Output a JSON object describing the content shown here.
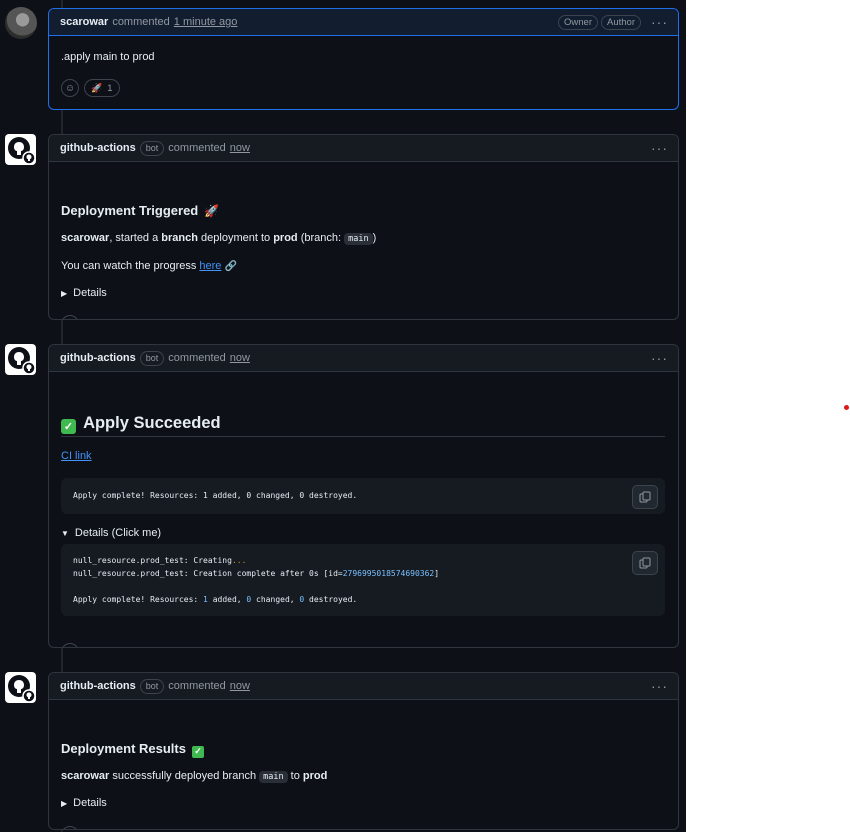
{
  "comment1": {
    "author": "scarowar",
    "action": "commented",
    "time": "1 minute ago",
    "badges": [
      "Owner",
      "Author"
    ],
    "body_text": ".apply main to prod",
    "reaction_emoji": "🚀",
    "reaction_count": "1"
  },
  "comment2": {
    "author": "github-actions",
    "bot_badge": "bot",
    "action": "commented",
    "time": "now",
    "heading": "Deployment Triggered",
    "heading_emoji": "🚀",
    "line1": {
      "user": "scarowar",
      "text_a": ", started a ",
      "kind": "branch",
      "text_b": " deployment to ",
      "env": "prod",
      "text_c": " (branch: ",
      "branch": "main",
      "text_d": ")"
    },
    "line2": {
      "text": "You can watch the progress ",
      "link": "here",
      "link_emoji": "🔗"
    },
    "details": "Details"
  },
  "comment3": {
    "author": "github-actions",
    "bot_badge": "bot",
    "action": "commented",
    "time": "now",
    "heading": "Apply Succeeded",
    "ci_link": "CI link",
    "summary_code": "Apply complete! Resources: 1 added, 0 changed, 0 destroyed.",
    "details": "Details (Click me)",
    "log": {
      "line1_prefix": "null_resource.prod_test: Creating",
      "line1_dots": "...",
      "line2_prefix": "null_resource.prod_test: Creation complete after 0s [id=",
      "line2_id": "2796995018574690362",
      "line2_suffix": "]",
      "line3": {
        "a": "Apply complete! Resources: ",
        "n1": "1",
        "b": " added, ",
        "n2": "0",
        "c": " changed, ",
        "n3": "0",
        "d": " destroyed."
      }
    }
  },
  "comment4": {
    "author": "github-actions",
    "bot_badge": "bot",
    "action": "commented",
    "time": "now",
    "heading": "Deployment Results",
    "line": {
      "user": "scarowar",
      "text_a": " successfully deployed branch ",
      "branch": "main",
      "text_b": " to ",
      "env": "prod"
    },
    "details": "Details"
  },
  "colors": {
    "background": "#0d1117",
    "border": "#30363d",
    "owner_border": "#1f6feb",
    "link": "#4493f8",
    "success": "#3fb950"
  }
}
